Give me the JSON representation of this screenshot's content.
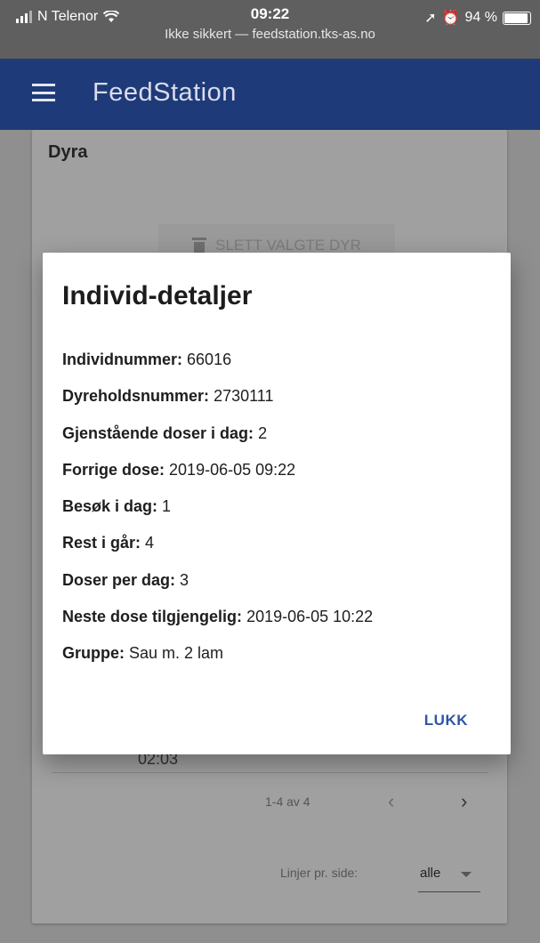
{
  "status_bar": {
    "carrier": "N Telenor",
    "time": "09:22",
    "url": "Ikke sikkert — feedstation.tks-as.no",
    "battery": "94 %",
    "battery_level": 0.94
  },
  "app_bar": {
    "title": "FeedStation"
  },
  "background": {
    "card_title": "Dyra",
    "delete_button": "SLETT VALGTE DYR",
    "row_time_partial": "02:03",
    "pagination": {
      "range": "1-4 av 4",
      "prev": "‹",
      "next": "›"
    },
    "rows_per_page": {
      "label": "Linjer pr. side:",
      "value": "alle"
    }
  },
  "dialog": {
    "title": "Individ-detaljer",
    "details": [
      {
        "label": "Individnummer:",
        "value": "66016"
      },
      {
        "label": "Dyreholdsnummer:",
        "value": "2730111"
      },
      {
        "label": "Gjenstående doser i dag:",
        "value": "2"
      },
      {
        "label": "Forrige dose:",
        "value": "2019-06-05 09:22"
      },
      {
        "label": "Besøk i dag:",
        "value": "1"
      },
      {
        "label": "Rest i går:",
        "value": "4"
      },
      {
        "label": "Doser per dag:",
        "value": "3"
      },
      {
        "label": "Neste dose tilgjengelig:",
        "value": "2019-06-05 10:22"
      },
      {
        "label": "Gruppe:",
        "value": "Sau m. 2 lam"
      }
    ],
    "close_button": "LUKK"
  }
}
